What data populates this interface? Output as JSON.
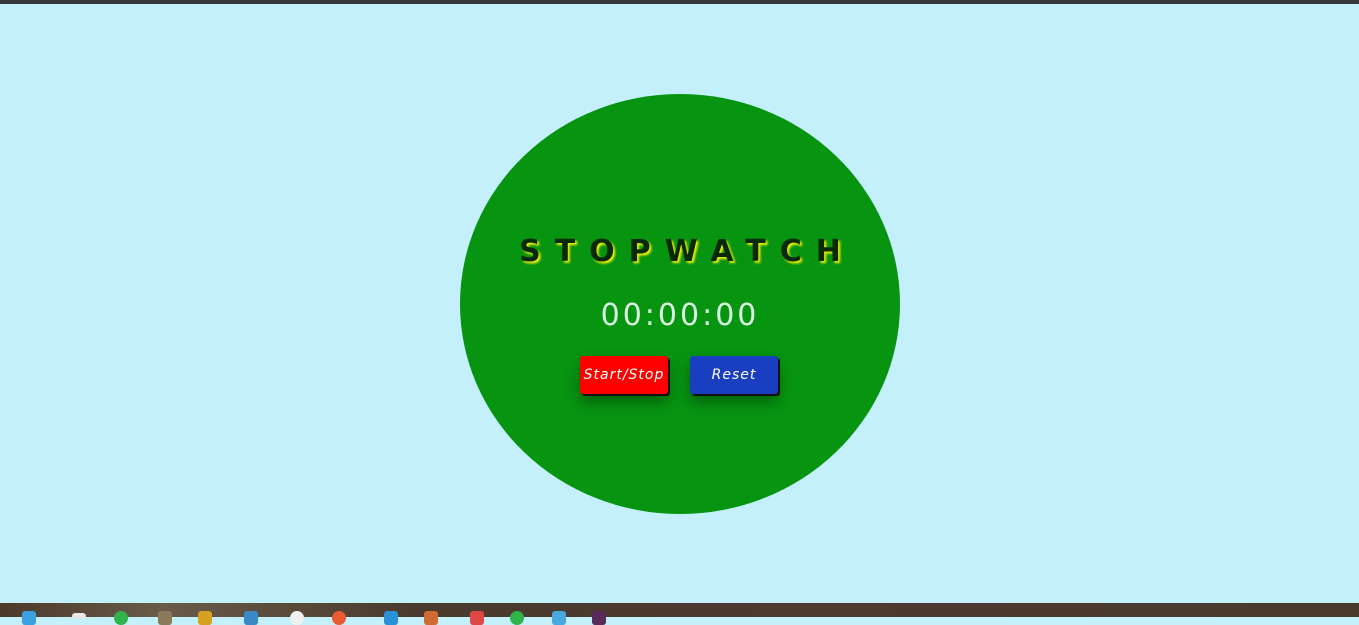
{
  "app": {
    "title": "STOPWATCH",
    "time_display": "00:00:00"
  },
  "buttons": {
    "start_stop_label": "Start/Stop",
    "reset_label": "Reset"
  },
  "colors": {
    "background": "#c4f0fc",
    "circle": "#079411",
    "title_text": "#062a06",
    "title_glow": "#f4f000",
    "time_text": "#d8f4e0",
    "start_stop_button": "#ff0000",
    "reset_button": "#1a3ec0"
  },
  "taskbar": {
    "icons": [
      "windows-start-icon",
      "task-view-icon",
      "chrome-icon",
      "file-explorer-icon",
      "folder-icon",
      "edge-icon",
      "search-icon",
      "brave-icon",
      "vscode-icon",
      "app-icon",
      "app-icon",
      "spotify-icon",
      "calculator-icon",
      "app-icon"
    ]
  }
}
